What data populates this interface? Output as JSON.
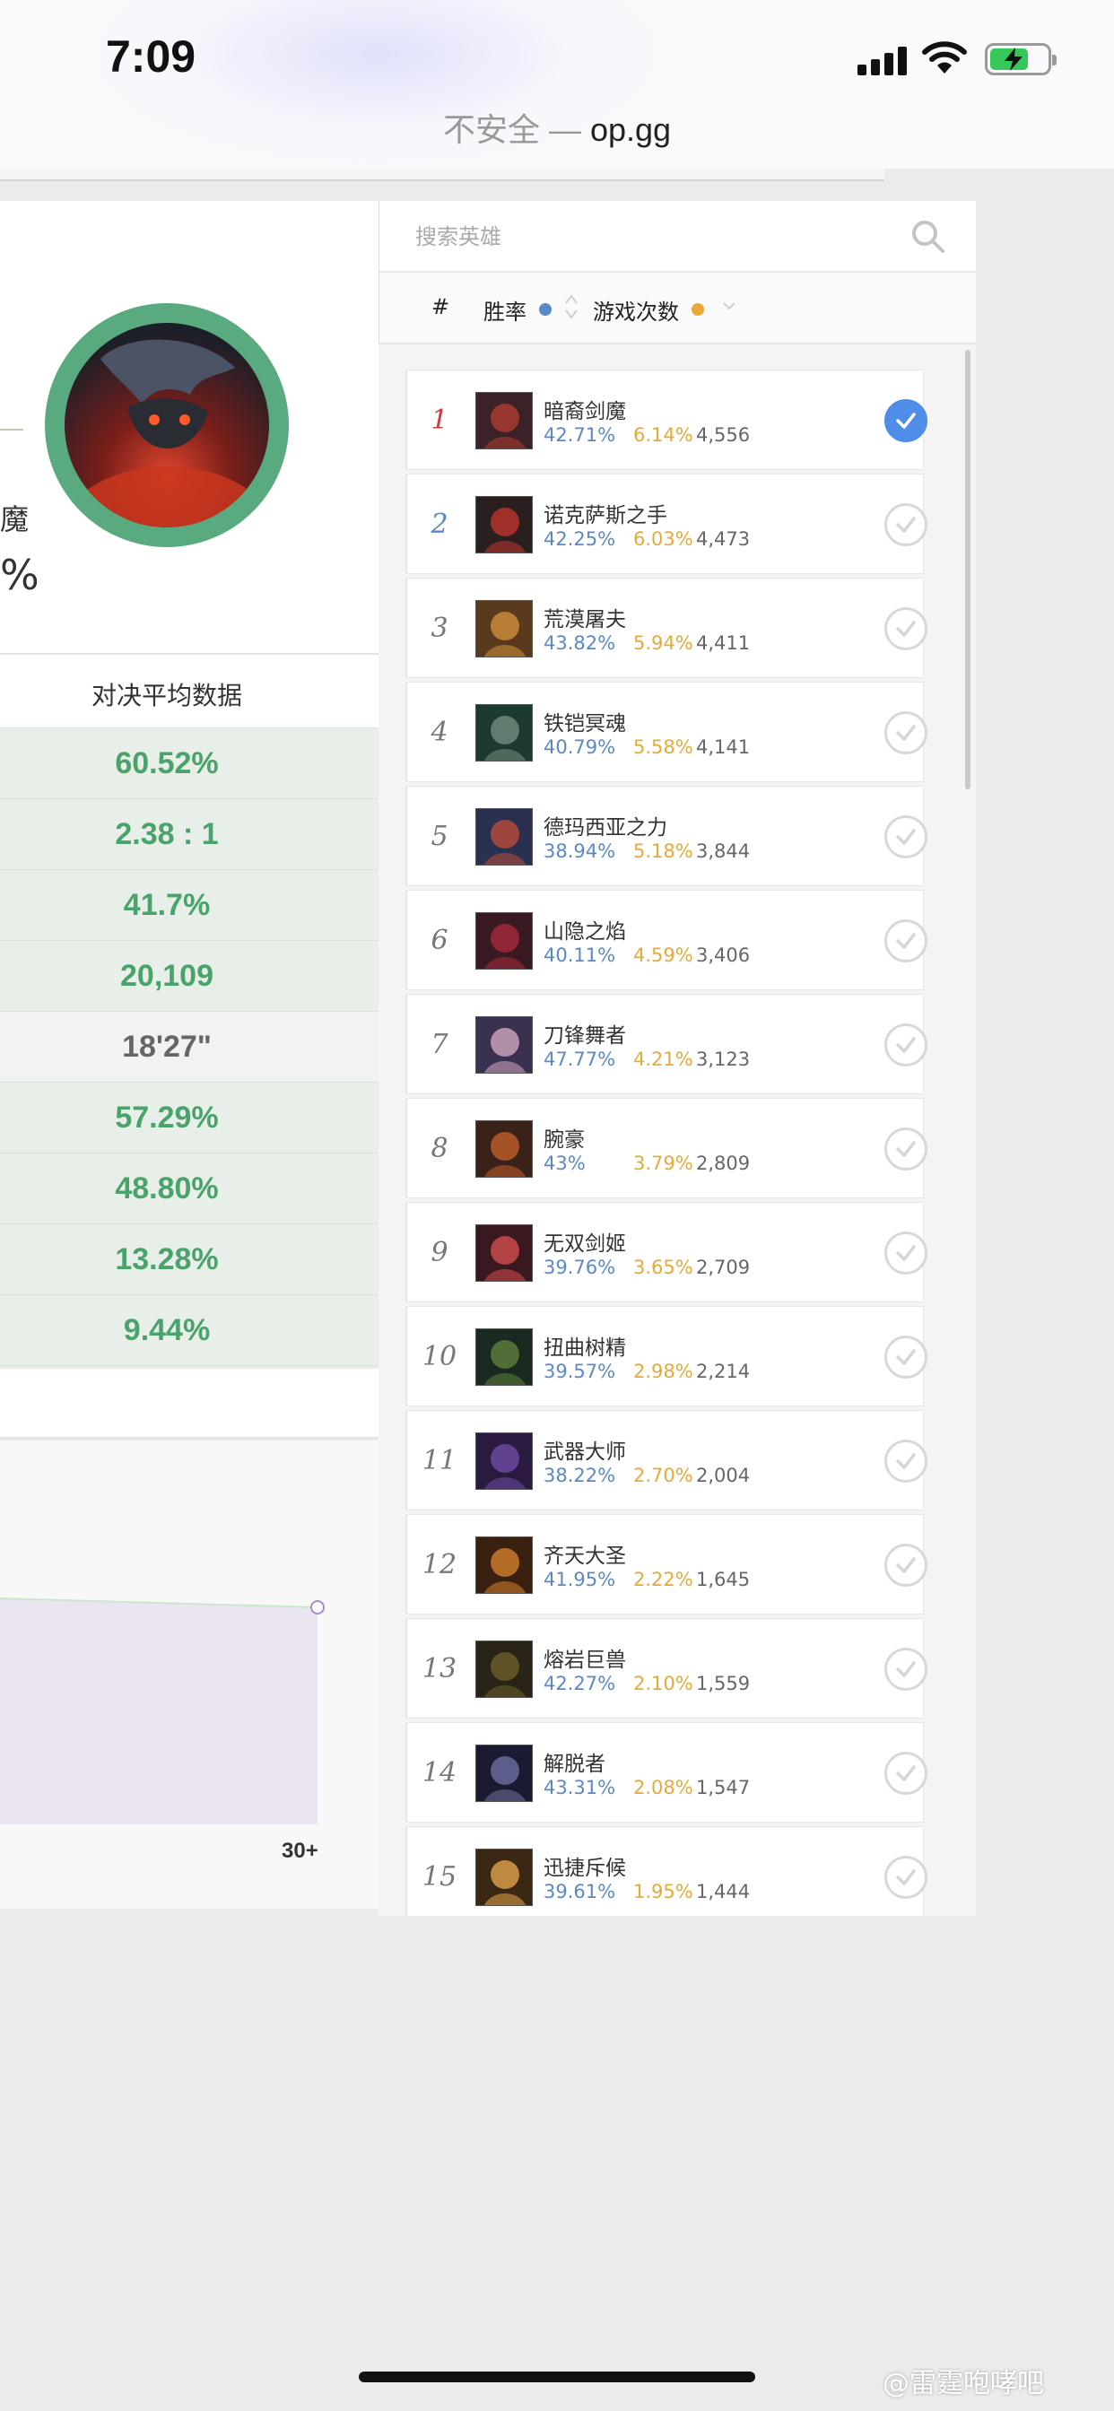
{
  "status_bar": {
    "time": "7:09"
  },
  "browser": {
    "insecure_label": "不安全 — ",
    "domain": "op.gg"
  },
  "champion": {
    "name_fragment": "魔",
    "pct_fragment": "%",
    "ring_color": "#5aaa7f"
  },
  "stats": {
    "header": "对决平均数据",
    "rows": [
      {
        "value": "60.52%",
        "highlight": true
      },
      {
        "value": "2.38 : 1",
        "highlight": true
      },
      {
        "value": "41.7%",
        "highlight": true
      },
      {
        "value": "20,109",
        "highlight": true
      },
      {
        "value": "18'27\"",
        "highlight": false
      },
      {
        "value": "57.29%",
        "highlight": true
      },
      {
        "value": "48.80%",
        "highlight": true
      },
      {
        "value": "13.28%",
        "highlight": true
      },
      {
        "value": "9.44%",
        "highlight": true
      }
    ],
    "highlight_bg": "#e7efe8",
    "highlight_text": "#4aa36a",
    "neutral_bg": "#f2f2f2",
    "neutral_text": "#666666"
  },
  "chart": {
    "x_tick_last": "30+"
  },
  "search": {
    "placeholder": "搜索英雄"
  },
  "sort_bar": {
    "hash": "#",
    "winrate": "胜率",
    "games": "游戏次数",
    "winrate_color": "#5b88c7",
    "games_color": "#e8a937"
  },
  "heroes": [
    {
      "rank": "1",
      "name": "暗裔剑魔",
      "winrate": "42.71%",
      "pickrate": "6.14%",
      "games": "4,556",
      "selected": true
    },
    {
      "rank": "2",
      "name": "诺克萨斯之手",
      "winrate": "42.25%",
      "pickrate": "6.03%",
      "games": "4,473",
      "selected": false
    },
    {
      "rank": "3",
      "name": "荒漠屠夫",
      "winrate": "43.82%",
      "pickrate": "5.94%",
      "games": "4,411",
      "selected": false
    },
    {
      "rank": "4",
      "name": "铁铠冥魂",
      "winrate": "40.79%",
      "pickrate": "5.58%",
      "games": "4,141",
      "selected": false
    },
    {
      "rank": "5",
      "name": "德玛西亚之力",
      "winrate": "38.94%",
      "pickrate": "5.18%",
      "games": "3,844",
      "selected": false
    },
    {
      "rank": "6",
      "name": "山隐之焰",
      "winrate": "40.11%",
      "pickrate": "4.59%",
      "games": "3,406",
      "selected": false
    },
    {
      "rank": "7",
      "name": "刀锋舞者",
      "winrate": "47.77%",
      "pickrate": "4.21%",
      "games": "3,123",
      "selected": false
    },
    {
      "rank": "8",
      "name": "腕豪",
      "winrate": "43%",
      "pickrate": "3.79%",
      "games": "2,809",
      "selected": false
    },
    {
      "rank": "9",
      "name": "无双剑姬",
      "winrate": "39.76%",
      "pickrate": "3.65%",
      "games": "2,709",
      "selected": false
    },
    {
      "rank": "10",
      "name": "扭曲树精",
      "winrate": "39.57%",
      "pickrate": "2.98%",
      "games": "2,214",
      "selected": false
    },
    {
      "rank": "11",
      "name": "武器大师",
      "winrate": "38.22%",
      "pickrate": "2.70%",
      "games": "2,004",
      "selected": false
    },
    {
      "rank": "12",
      "name": "齐天大圣",
      "winrate": "41.95%",
      "pickrate": "2.22%",
      "games": "1,645",
      "selected": false
    },
    {
      "rank": "13",
      "name": "熔岩巨兽",
      "winrate": "42.27%",
      "pickrate": "2.10%",
      "games": "1,559",
      "selected": false
    },
    {
      "rank": "14",
      "name": "解脱者",
      "winrate": "43.31%",
      "pickrate": "2.08%",
      "games": "1,547",
      "selected": false
    },
    {
      "rank": "15",
      "name": "迅捷斥候",
      "winrate": "39.61%",
      "pickrate": "1.95%",
      "games": "1,444",
      "selected": false
    }
  ],
  "watermark": "@雷霆咆哮吧"
}
